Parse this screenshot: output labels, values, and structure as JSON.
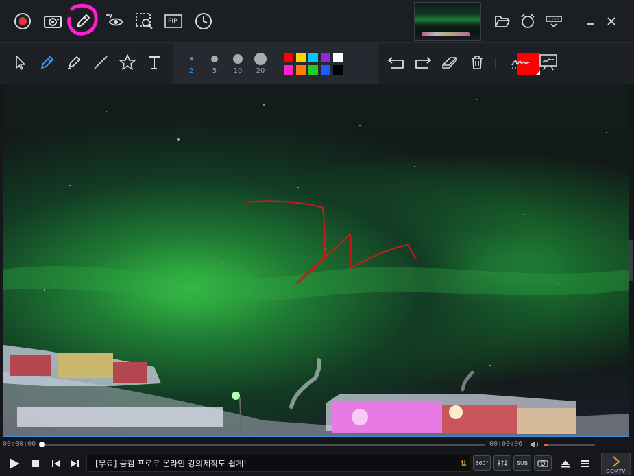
{
  "toolbar": {
    "pip_label": "PIP"
  },
  "drawing": {
    "sizes": [
      {
        "label": "2",
        "active": true
      },
      {
        "label": "5",
        "active": false
      },
      {
        "label": "10",
        "active": false
      },
      {
        "label": "20",
        "active": false
      }
    ],
    "palette": [
      "#ff0000",
      "#ffd400",
      "#00c8ff",
      "#8a2be2",
      "#ffffff",
      "#ff1fd1",
      "#ff7a00",
      "#20d020",
      "#1f5bff",
      "#000000"
    ],
    "current_color": "#ff0000",
    "accent_color": "#3d9cf5"
  },
  "player": {
    "time_current": "00:00:00",
    "time_total": "00:00:06",
    "progress": 0.0,
    "volume": 0.08,
    "ticker_text": "[무료] 곰캠 프로로 온라인 강의제작도 쉽게!",
    "btn_360": "360°",
    "btn_sub": "SUB",
    "brand": "GOMTV"
  }
}
